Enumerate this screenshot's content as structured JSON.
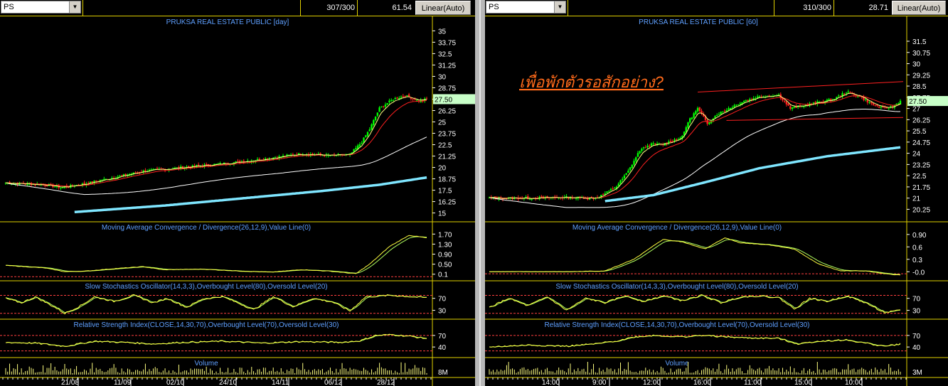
{
  "left": {
    "symbol": "PS",
    "counter": "307/300",
    "value": "61.54",
    "scale_mode": "Linear(Auto)"
  },
  "right": {
    "symbol": "PS",
    "counter": "310/300",
    "value": "28.71",
    "scale_mode": "Linear(Auto)"
  },
  "colors": {
    "price_title": "#5fa0ff",
    "up_candle": "#00ff00",
    "down_candle": "#ff2020",
    "ma_short": "#ffff80",
    "ma_mid": "#ff2020",
    "ma_long": "#ffffff",
    "ma_longest": "#7fe6ff",
    "macd": "#ffff40",
    "signal": "#b0ff60",
    "level_line": "#ff4040",
    "annotation": "#ff6a1a",
    "border": "#e0d000"
  },
  "chart_data": [
    {
      "type": "candlestick",
      "title": "PRUKSA REAL ESTATE PUBLIC [day]",
      "last_price_label": "27.50",
      "ylim": [
        14.5,
        35.5
      ],
      "y_ticks": [
        "35",
        "33.75",
        "32.5",
        "31.25",
        "30",
        "28.75",
        "27.5",
        "26.25",
        "25",
        "23.75",
        "22.5",
        "21.25",
        "20",
        "18.75",
        "17.5",
        "16.25",
        "15"
      ],
      "x_ticks": [
        "21/08",
        "11/09",
        "02/10",
        "24/10",
        "14/11",
        "06/12",
        "28/12"
      ],
      "price_waypoints": [
        [
          0,
          18.3
        ],
        [
          20,
          18.1
        ],
        [
          28,
          17.8
        ],
        [
          40,
          18.2
        ],
        [
          55,
          18.9
        ],
        [
          70,
          19.6
        ],
        [
          90,
          20.0
        ],
        [
          110,
          20.4
        ],
        [
          130,
          20.9
        ],
        [
          150,
          21.5
        ],
        [
          165,
          21.3
        ],
        [
          175,
          21.4
        ],
        [
          181,
          22.8
        ],
        [
          185,
          24.2
        ],
        [
          190,
          26.5
        ],
        [
          197,
          27.5
        ],
        [
          203,
          27.9
        ],
        [
          210,
          27.3
        ],
        [
          214,
          27.5
        ]
      ],
      "ma_longest_waypoints": [
        [
          35,
          15.1
        ],
        [
          80,
          15.8
        ],
        [
          120,
          16.6
        ],
        [
          160,
          17.4
        ],
        [
          190,
          18.1
        ],
        [
          214,
          18.9
        ]
      ],
      "indicators": [
        {
          "title": "Moving Average Convergence / Divergence(26,12,9),Value Line(0)",
          "ylim": [
            -0.05,
            1.85
          ],
          "y_ticks": [
            "1.70",
            "1.30",
            "0.90",
            "0.50",
            "0.1"
          ],
          "levels": [
            0
          ],
          "waypoints": [
            [
              0,
              0.45
            ],
            [
              20,
              0.35
            ],
            [
              30,
              0.2
            ],
            [
              40,
              0.22
            ],
            [
              55,
              0.32
            ],
            [
              70,
              0.4
            ],
            [
              80,
              0.28
            ],
            [
              100,
              0.3
            ],
            [
              120,
              0.22
            ],
            [
              135,
              0.18
            ],
            [
              150,
              0.28
            ],
            [
              165,
              0.22
            ],
            [
              178,
              0.12
            ],
            [
              185,
              0.5
            ],
            [
              195,
              1.2
            ],
            [
              205,
              1.65
            ],
            [
              214,
              1.55
            ]
          ]
        },
        {
          "title": "Slow Stochastics Oscillator(14,3,3),Overbought Level(80),Oversold Level(20)",
          "ylim": [
            10,
            100
          ],
          "y_ticks": [
            "70",
            "30"
          ],
          "levels": [
            80,
            20
          ],
          "waypoints": [
            [
              0,
              70
            ],
            [
              8,
              55
            ],
            [
              15,
              75
            ],
            [
              25,
              40
            ],
            [
              30,
              20
            ],
            [
              38,
              45
            ],
            [
              45,
              75
            ],
            [
              55,
              60
            ],
            [
              65,
              80
            ],
            [
              75,
              55
            ],
            [
              82,
              70
            ],
            [
              92,
              40
            ],
            [
              100,
              68
            ],
            [
              110,
              76
            ],
            [
              118,
              55
            ],
            [
              126,
              32
            ],
            [
              136,
              76
            ],
            [
              146,
              42
            ],
            [
              156,
              70
            ],
            [
              166,
              58
            ],
            [
              175,
              28
            ],
            [
              183,
              75
            ],
            [
              195,
              80
            ],
            [
              205,
              76
            ],
            [
              214,
              72
            ]
          ]
        },
        {
          "title": "Relative Strength Index(CLOSE,14,30,70),Overbought Level(70),Oversold Level(30)",
          "ylim": [
            20,
            90
          ],
          "y_ticks": [
            "70",
            "40"
          ],
          "levels": [
            70,
            30
          ],
          "waypoints": [
            [
              0,
              52
            ],
            [
              15,
              50
            ],
            [
              30,
              42
            ],
            [
              45,
              55
            ],
            [
              60,
              52
            ],
            [
              75,
              48
            ],
            [
              90,
              52
            ],
            [
              110,
              55
            ],
            [
              130,
              50
            ],
            [
              150,
              54
            ],
            [
              170,
              52
            ],
            [
              180,
              56
            ],
            [
              188,
              70
            ],
            [
              196,
              72
            ],
            [
              205,
              68
            ],
            [
              214,
              62
            ]
          ]
        },
        {
          "title": "Volume",
          "type": "volume",
          "y_ticks": [
            "8M"
          ]
        }
      ]
    },
    {
      "type": "candlestick",
      "title": "PRUKSA REAL ESTATE PUBLIC [60]",
      "last_price_label": "27.50",
      "ylim": [
        19.7,
        32.5
      ],
      "y_ticks": [
        "31.5",
        "30.75",
        "30",
        "29.25",
        "28.5",
        "27.75",
        "27",
        "26.25",
        "25.5",
        "24.75",
        "24",
        "23.25",
        "22.5",
        "21.75",
        "21",
        "20.25"
      ],
      "x_ticks": [
        "14:00",
        "9:00",
        "12:00",
        "16:00",
        "11:00",
        "15:00",
        "10:00"
      ],
      "annotation": "เพื่อพักตัวรอสักอย่าง?",
      "price_waypoints": [
        [
          0,
          21.0
        ],
        [
          20,
          21.0
        ],
        [
          40,
          21.05
        ],
        [
          55,
          21.0
        ],
        [
          60,
          21.3
        ],
        [
          66,
          21.8
        ],
        [
          72,
          22.8
        ],
        [
          78,
          24.2
        ],
        [
          84,
          24.6
        ],
        [
          90,
          24.6
        ],
        [
          100,
          25.1
        ],
        [
          103,
          26.1
        ],
        [
          108,
          27.0
        ],
        [
          113,
          26.0
        ],
        [
          118,
          26.6
        ],
        [
          124,
          27.0
        ],
        [
          132,
          27.5
        ],
        [
          140,
          27.8
        ],
        [
          150,
          27.9
        ],
        [
          156,
          27.0
        ],
        [
          163,
          27.2
        ],
        [
          170,
          27.4
        ],
        [
          178,
          27.6
        ],
        [
          185,
          28.1
        ],
        [
          192,
          27.8
        ],
        [
          198,
          27.3
        ],
        [
          204,
          27.0
        ],
        [
          209,
          27.1
        ],
        [
          213,
          27.5
        ]
      ],
      "ma_longest_waypoints": [
        [
          60,
          20.8
        ],
        [
          85,
          21.2
        ],
        [
          110,
          22.0
        ],
        [
          140,
          23.0
        ],
        [
          175,
          23.8
        ],
        [
          213,
          24.4
        ]
      ],
      "channel": {
        "upper": [
          [
            108,
            28.1
          ],
          [
            213,
            28.8
          ]
        ],
        "lower": [
          [
            145,
            26.2
          ],
          [
            213,
            26.4
          ]
        ]
      },
      "indicators": [
        {
          "title": "Moving Average Convergence / Divergence(26,12,9),Value Line(0)",
          "ylim": [
            -0.15,
            1.0
          ],
          "y_ticks": [
            "0.90",
            "0.6",
            "0.3",
            "-0.0"
          ],
          "levels": [
            -0.05
          ],
          "waypoints": [
            [
              0,
              0
            ],
            [
              40,
              0
            ],
            [
              60,
              0.02
            ],
            [
              75,
              0.3
            ],
            [
              90,
              0.78
            ],
            [
              100,
              0.72
            ],
            [
              112,
              0.55
            ],
            [
              122,
              0.82
            ],
            [
              130,
              0.7
            ],
            [
              145,
              0.65
            ],
            [
              158,
              0.55
            ],
            [
              170,
              0.2
            ],
            [
              182,
              0.02
            ],
            [
              195,
              0.02
            ],
            [
              205,
              -0.05
            ],
            [
              213,
              -0.08
            ]
          ]
        },
        {
          "title": "Slow Stochastics Oscillator(14,3,3),Overbought Level(80),Oversold Level(20)",
          "ylim": [
            10,
            100
          ],
          "y_ticks": [
            "70",
            "30"
          ],
          "levels": [
            80,
            20
          ],
          "waypoints": [
            [
              0,
              40
            ],
            [
              10,
              70
            ],
            [
              20,
              45
            ],
            [
              30,
              75
            ],
            [
              40,
              30
            ],
            [
              50,
              70
            ],
            [
              60,
              55
            ],
            [
              70,
              78
            ],
            [
              80,
              60
            ],
            [
              90,
              78
            ],
            [
              100,
              62
            ],
            [
              110,
              80
            ],
            [
              120,
              55
            ],
            [
              130,
              75
            ],
            [
              140,
              78
            ],
            [
              150,
              72
            ],
            [
              158,
              35
            ],
            [
              166,
              70
            ],
            [
              175,
              60
            ],
            [
              185,
              78
            ],
            [
              195,
              55
            ],
            [
              205,
              22
            ],
            [
              213,
              30
            ]
          ]
        },
        {
          "title": "Relative Strength Index(CLOSE,14,30,70),Overbought Level(70),Oversold Level(30)",
          "ylim": [
            20,
            90
          ],
          "y_ticks": [
            "70",
            "40"
          ],
          "levels": [
            70,
            30
          ],
          "waypoints": [
            [
              0,
              40
            ],
            [
              20,
              45
            ],
            [
              40,
              42
            ],
            [
              55,
              48
            ],
            [
              65,
              55
            ],
            [
              75,
              66
            ],
            [
              85,
              70
            ],
            [
              100,
              66
            ],
            [
              110,
              70
            ],
            [
              130,
              64
            ],
            [
              150,
              62
            ],
            [
              160,
              48
            ],
            [
              170,
              55
            ],
            [
              185,
              58
            ],
            [
              195,
              50
            ],
            [
              205,
              42
            ],
            [
              213,
              48
            ]
          ]
        },
        {
          "title": "Volume",
          "type": "volume",
          "y_ticks": [
            "3M"
          ]
        }
      ]
    }
  ]
}
